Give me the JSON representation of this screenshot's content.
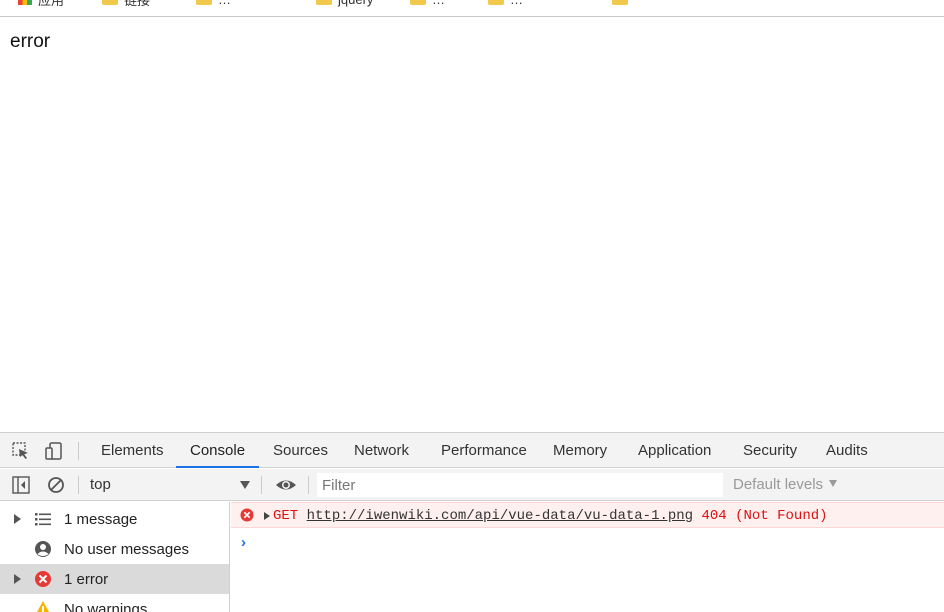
{
  "bookmarks": {
    "items": [
      {
        "label": "应用",
        "icon": "apps-icon"
      },
      {
        "label": "链接",
        "icon": "folder-icon"
      },
      {
        "label": "…",
        "icon": "folder-icon"
      },
      {
        "label": "jquery",
        "icon": "folder-icon"
      },
      {
        "label": "…",
        "icon": "folder-icon"
      },
      {
        "label": "…",
        "icon": "folder-icon"
      }
    ]
  },
  "page": {
    "text": "error"
  },
  "devtools": {
    "tabs": [
      "Elements",
      "Console",
      "Sources",
      "Network",
      "Performance",
      "Memory",
      "Application",
      "Security",
      "Audits"
    ],
    "active_tab": "Console",
    "toolbar": {
      "context": "top",
      "filter_placeholder": "Filter",
      "levels": "Default levels"
    },
    "sidebar": {
      "items": [
        {
          "label": "1 message",
          "icon": "list-icon",
          "expandable": true
        },
        {
          "label": "No user messages",
          "icon": "user-icon",
          "expandable": false
        },
        {
          "label": "1 error",
          "icon": "error-icon",
          "expandable": true,
          "selected": true
        },
        {
          "label": "No warnings",
          "icon": "warning-icon",
          "expandable": false
        }
      ]
    },
    "console": {
      "error": {
        "method": "GET",
        "url": "http://iwenwiki.com/api/vue-data/vu-data-1.png",
        "status": "404 (Not Found)"
      },
      "prompt": "›"
    }
  },
  "colors": {
    "accent": "#1a73e8",
    "error": "#e01010",
    "error_bg": "#fff0f0",
    "warning": "#f4b400"
  }
}
